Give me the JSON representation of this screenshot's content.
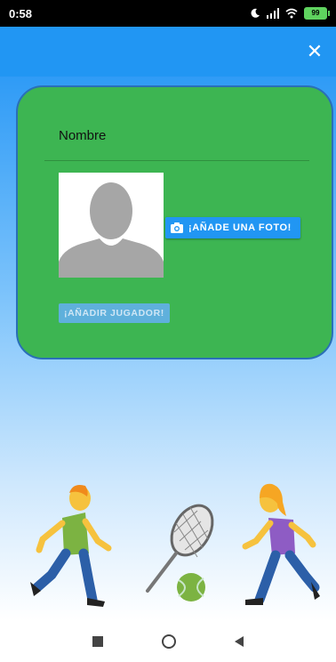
{
  "status_bar": {
    "time": "0:58",
    "battery": "99"
  },
  "form": {
    "name_value": "Nombre",
    "add_photo_label": "¡AÑADE UNA FOTO!",
    "add_player_label": "¡AÑADIR JUGADOR!"
  },
  "icons": {
    "close": "close-icon",
    "camera": "camera-icon",
    "moon": "moon-icon",
    "signal": "signal-icon",
    "wifi": "wifi-icon",
    "battery": "battery-icon"
  },
  "colors": {
    "app_bar": "#2196f3",
    "card": "#3db552",
    "button": "#2196f3"
  }
}
